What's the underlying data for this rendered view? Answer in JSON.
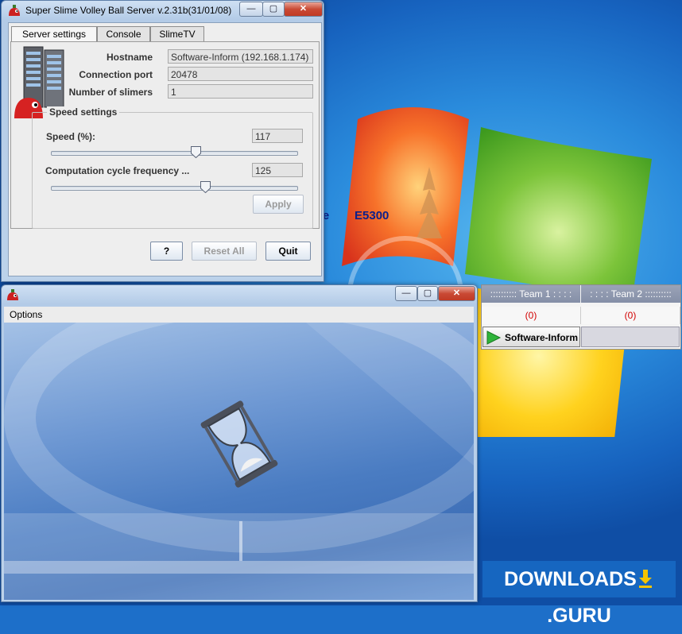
{
  "desktop": {
    "text_fragment_1": "re",
    "text_fragment_2": "E5300"
  },
  "server_window": {
    "title": "Super Slime Volley Ball Server  v.2.31b(31/01/08)",
    "tabs": [
      {
        "label": "Server settings",
        "active": true
      },
      {
        "label": "Console",
        "active": false
      },
      {
        "label": "SlimeTV",
        "active": false
      }
    ],
    "fields": {
      "hostname_label": "Hostname",
      "hostname_value": "Software-Inform (192.168.1.174)",
      "port_label": "Connection port",
      "port_value": "20478",
      "slimers_label": "Number of slimers",
      "slimers_value": "1"
    },
    "speed_settings": {
      "group_label": "Speed settings",
      "speed_label": "Speed (%):",
      "speed_value": "117",
      "speed_slider_fraction": 0.59,
      "freq_label": "Computation cycle frequency ...",
      "freq_value": "125",
      "freq_slider_fraction": 0.63,
      "apply_label": "Apply"
    },
    "buttons": {
      "help_label": "?",
      "reset_label": "Reset All",
      "quit_label": "Quit"
    }
  },
  "game_window": {
    "menu_options": "Options"
  },
  "score_panel": {
    "team1_header": ":::::::::: Team 1 : : :  :",
    "team2_header": ": : : : Team 2 ::::::::::",
    "team1_score": "(0)",
    "team2_score": "(0)",
    "player_name": "Software-Inform"
  },
  "watermark": {
    "text_left": "DOWNLOADS",
    "text_right": ".GURU"
  },
  "colors": {
    "score_red": "#d20000",
    "desktop_blue": "#1d6fc9"
  }
}
